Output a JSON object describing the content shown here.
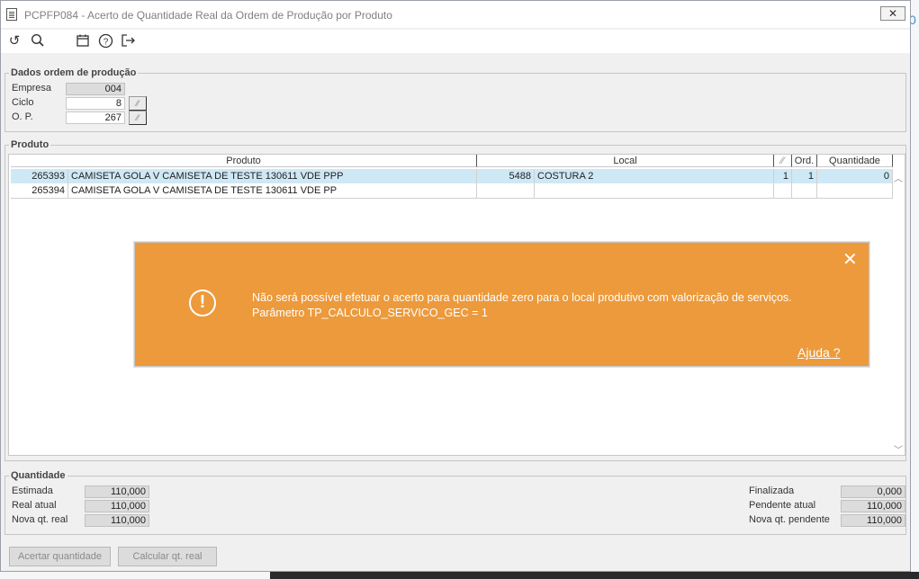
{
  "window": {
    "title": "PCPFP084 - Acerto de Quantidade Real da Ordem de Produção por Produto",
    "close_glyph": "✕"
  },
  "toolbar": [
    {
      "name": "refresh-icon",
      "glyph": "↺"
    },
    {
      "name": "search-icon",
      "glyph": "⚲"
    },
    {
      "name": "calendar-icon",
      "glyph": "▦"
    },
    {
      "name": "help-icon",
      "glyph": "?"
    },
    {
      "name": "exit-icon",
      "glyph": "⇥"
    }
  ],
  "ordem": {
    "legend": "Dados ordem de produção",
    "empresa_label": "Empresa",
    "empresa_value": "004",
    "ciclo_label": "Ciclo",
    "ciclo_value": "8",
    "op_label": "O. P.",
    "op_value": "267"
  },
  "produto": {
    "legend": "Produto",
    "headers": {
      "produto": "Produto",
      "local": "Local",
      "flag": "",
      "ord": "Ord.",
      "quantidade": "Quantidade"
    },
    "rows": [
      {
        "code": "265393",
        "desc": "CAMISETA GOLA V CAMISETA DE TESTE 130611 VDE PPP",
        "local_code": "5488",
        "local": "COSTURA 2",
        "flag": "1",
        "ord": "1",
        "qty": "0"
      },
      {
        "code": "265394",
        "desc": "CAMISETA GOLA V CAMISETA DE TESTE 130611 VDE PP",
        "local_code": "",
        "local": "",
        "flag": "",
        "ord": "",
        "qty": ""
      }
    ]
  },
  "toast": {
    "message": "Não será possível efetuar o acerto para quantidade zero para o local produtivo com valorização de serviços. Parâmetro TP_CALCULO_SERVICO_GEC  = 1",
    "help": "Ajuda ?",
    "color": "#ec9a3c"
  },
  "quantidade": {
    "legend": "Quantidade",
    "estimada_label": "Estimada",
    "estimada_value": "110,000",
    "real_label": "Real atual",
    "real_value": "110,000",
    "nova_label": "Nova qt. real",
    "nova_value": "110,000",
    "finalizada_label": "Finalizada",
    "finalizada_value": "0,000",
    "pendente_label": "Pendente atual",
    "pendente_value": "110,000",
    "nova_pend_label": "Nova qt. pendente",
    "nova_pend_value": "110,000"
  },
  "buttons": {
    "acertar": "Acertar quantidade",
    "calcular": "Calcular qt. real"
  }
}
